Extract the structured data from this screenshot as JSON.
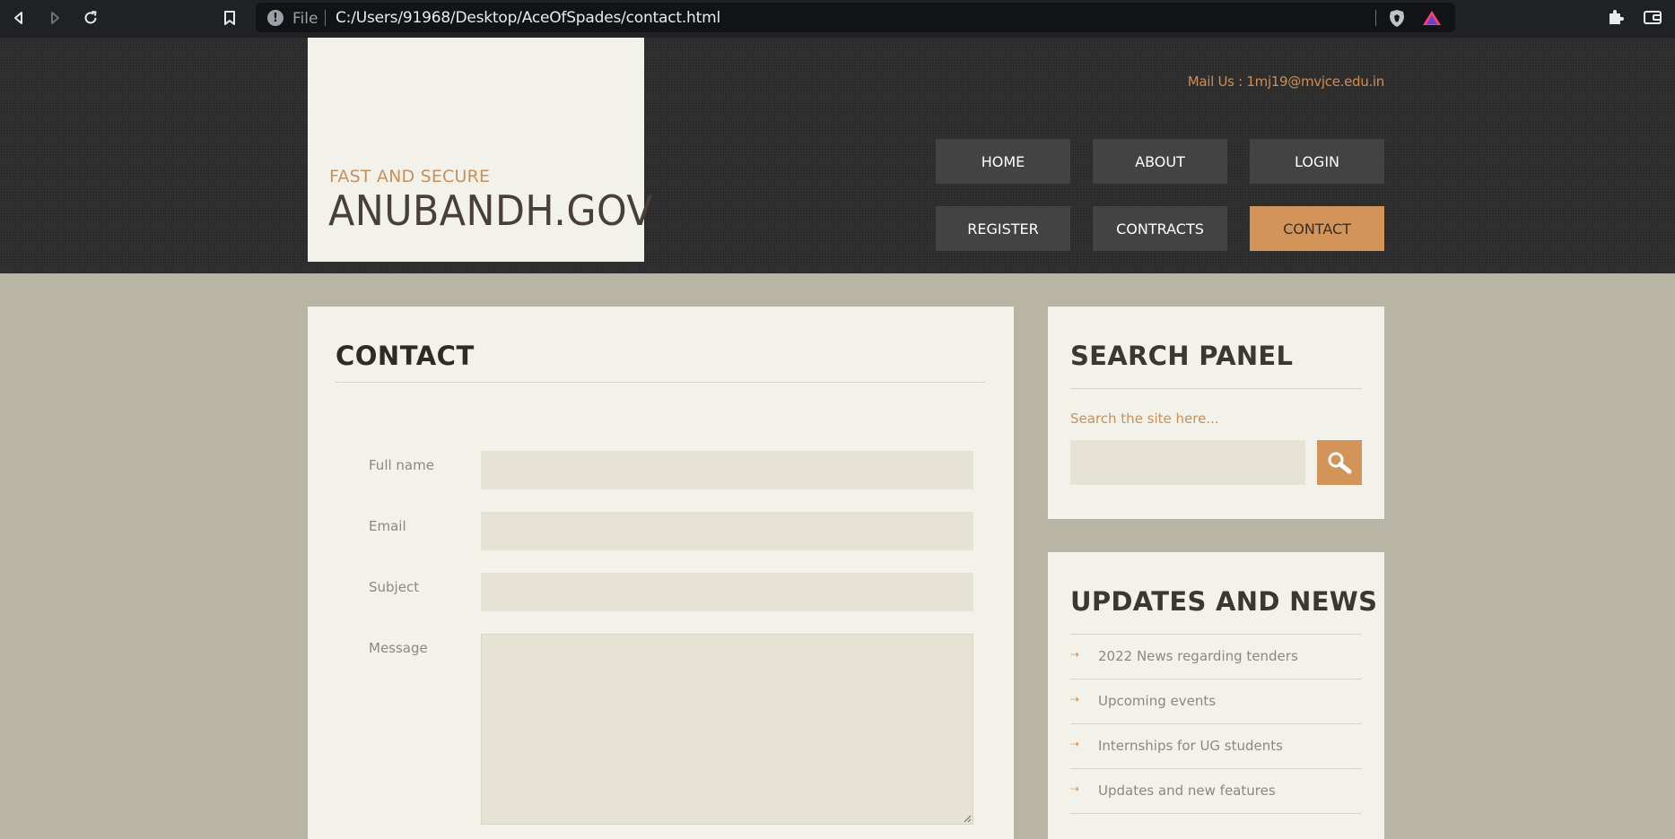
{
  "browser": {
    "file_label": "File",
    "url": "C:/Users/91968/Desktop/AceOfSpades/contact.html",
    "info_glyph": "!",
    "icons": [
      "back-icon",
      "forward-icon",
      "reload-icon",
      "bookmark-icon",
      "info-icon",
      "brave-shield-icon",
      "brave-rewards-icon",
      "extensions-icon",
      "wallet-icon"
    ]
  },
  "header": {
    "tagline": "FAST AND SECURE",
    "site_title": "ANUBANDH.GOV",
    "mail": "Mail Us : 1mj19@mvjce.edu.in",
    "nav": [
      {
        "label": "HOME"
      },
      {
        "label": "ABOUT"
      },
      {
        "label": "LOGIN"
      },
      {
        "label": "REGISTER"
      },
      {
        "label": "CONTRACTS"
      },
      {
        "label": "CONTACT",
        "active": true
      }
    ]
  },
  "contact": {
    "title": "CONTACT",
    "fields": [
      {
        "label": "Full name",
        "value": ""
      },
      {
        "label": "Email",
        "value": ""
      },
      {
        "label": "Subject",
        "value": ""
      },
      {
        "label": "Message",
        "value": ""
      }
    ]
  },
  "search_panel": {
    "title": "SEARCH PANEL",
    "hint": "Search the site here...",
    "value": "",
    "button_icon": "magnifier-icon"
  },
  "updates": {
    "title": "UPDATES AND NEWS",
    "bullet": "⇢",
    "items": [
      "2022 News regarding tenders",
      "Upcoming events",
      "Internships for UG students",
      "Updates and new features"
    ]
  },
  "colors": {
    "accent": "#d39459",
    "header_bg": "#2e2e2e",
    "page_bg": "#b9b5a5",
    "card_bg": "#f2f2eb"
  }
}
